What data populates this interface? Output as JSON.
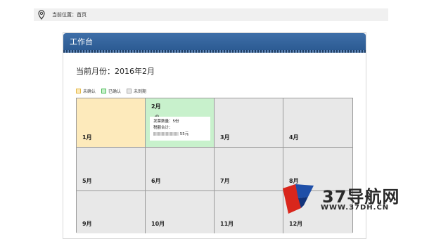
{
  "breadcrumb": {
    "text": "当前位置：首页",
    "icon": "location-pin-icon"
  },
  "panel": {
    "title": "工作台"
  },
  "current_month": "当前月份：2016年2月",
  "legend": [
    {
      "label": "未确认",
      "color": "#fde9b6"
    },
    {
      "label": "已确认",
      "color": "#c9f0cc"
    },
    {
      "label": "未到期",
      "color": "#e6e6e6"
    }
  ],
  "calendar": {
    "months": [
      {
        "label": "1月",
        "status": "未确认"
      },
      {
        "label": "2月",
        "status": "已确认"
      },
      {
        "label": "3月",
        "status": "未到期"
      },
      {
        "label": "4月",
        "status": "未到期"
      },
      {
        "label": "5月",
        "status": "未到期"
      },
      {
        "label": "6月",
        "status": "未到期"
      },
      {
        "label": "7月",
        "status": "未到期"
      },
      {
        "label": "8月",
        "status": "未到期"
      },
      {
        "label": "9月",
        "status": "未到期"
      },
      {
        "label": "10月",
        "status": "未到期"
      },
      {
        "label": "11月",
        "status": "未到期"
      },
      {
        "label": "12月",
        "status": "未到期"
      }
    ],
    "invoice_card": {
      "count_line": "发票数量：5份",
      "tax_label": "税额合计：",
      "tax_amount": "55元"
    }
  },
  "watermark": {
    "title": "37导航网",
    "url": "WWW.37DH.CN"
  },
  "colors": {
    "header_blue": "#2c5b93",
    "unconfirmed": "#fdeabb",
    "confirmed": "#c8f1cc",
    "pending": "#e8e8e8"
  }
}
